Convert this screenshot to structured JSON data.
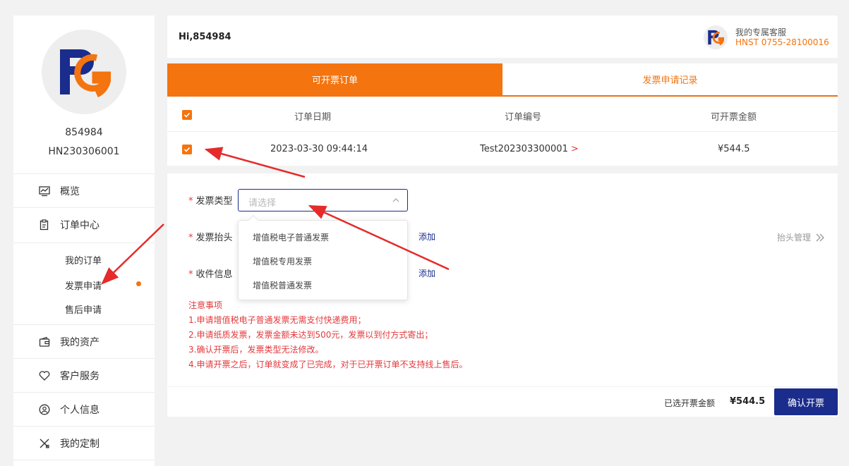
{
  "sidebar": {
    "username": "854984",
    "user_id": "HN230306001",
    "menu": {
      "overview": "概览",
      "order_center": "订单中心",
      "my_orders": "我的订单",
      "invoice_apply": "发票申请",
      "after_sales": "售后申请",
      "my_assets": "我的资产",
      "customer_service": "客户服务",
      "personal_info": "个人信息",
      "my_custom": "我的定制"
    }
  },
  "header": {
    "greeting": "Hi,854984",
    "service_title": "我的专属客服",
    "service_phone": "HNST  0755-28100016"
  },
  "tabs": {
    "active": "可开票订单",
    "inactive": "发票申请记录"
  },
  "table": {
    "headers": [
      "订单日期",
      "订单编号",
      "可开票金额"
    ],
    "rows": [
      {
        "date": "2023-03-30 09:44:14",
        "order_no": "Test202303300001",
        "amount": "¥544.5",
        "link_arrow": ">"
      }
    ]
  },
  "form": {
    "invoice_type_label": "发票类型",
    "invoice_type_placeholder": "请选择",
    "invoice_title_label": "发票抬头",
    "recipient_label": "收件信息",
    "add_link": "添加",
    "title_manage": "抬头管理",
    "options": [
      "增值税电子普通发票",
      "增值税专用发票",
      "增值税普通发票"
    ],
    "notes_title": "注意事项",
    "notes": [
      "1.申请增值税电子普通发票无需支付快递费用；",
      "2.申请纸质发票，发票金额未达到500元，发票以到付方式寄出；",
      "3.确认开票后，发票类型无法修改。",
      "4.申请开票之后，订单就变成了已完成，对于已开票订单不支持线上售后。"
    ]
  },
  "footer": {
    "selected_label": "已选开票金额",
    "selected_amount": "¥544.5",
    "confirm_button": "确认开票"
  },
  "colors": {
    "accent_orange": "#f4740f",
    "brand_navy": "#1a2c8c",
    "warning_red": "#e4393c"
  }
}
